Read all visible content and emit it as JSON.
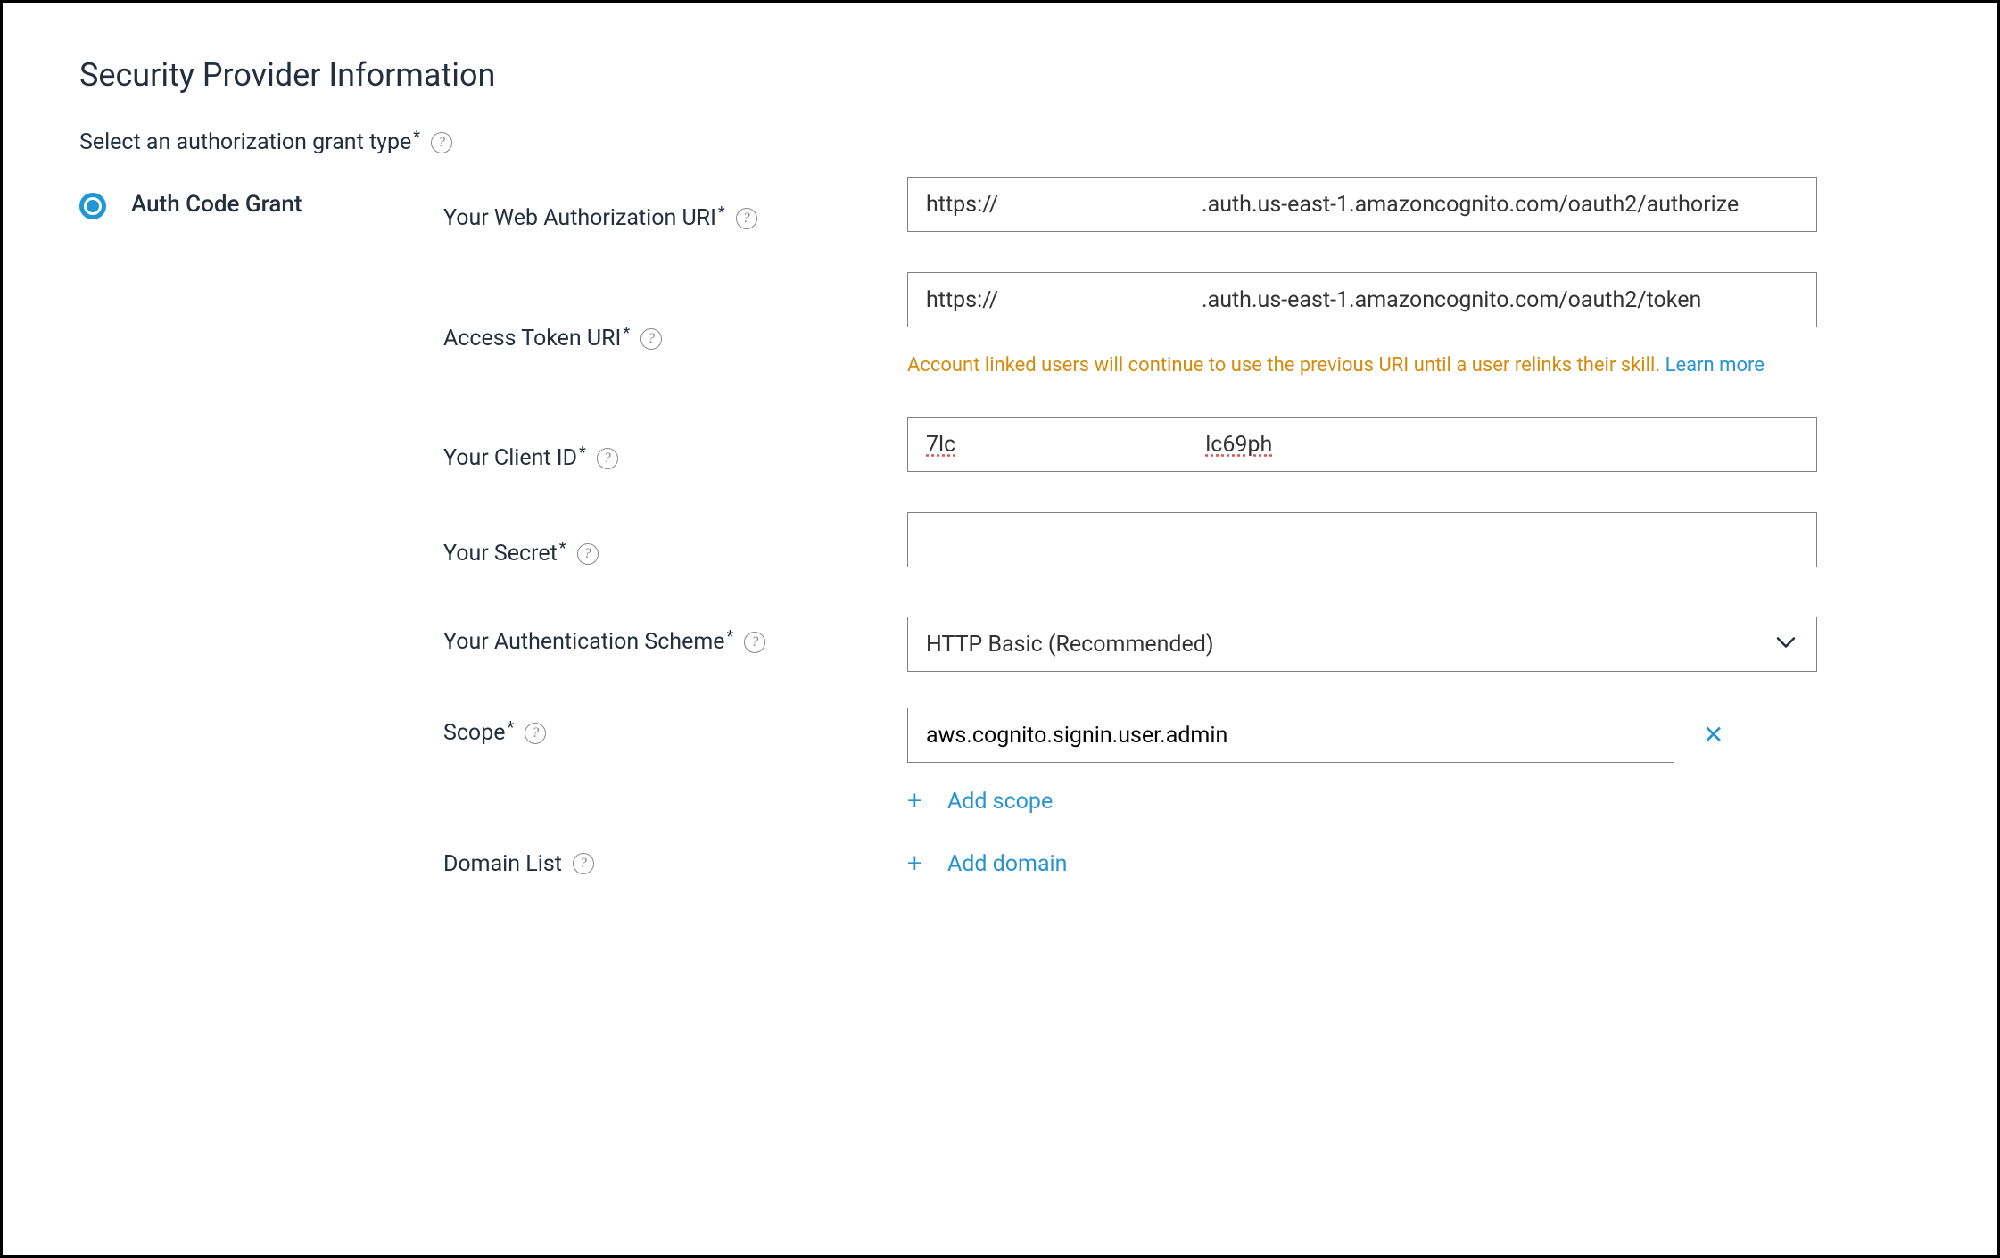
{
  "section": {
    "title": "Security Provider Information"
  },
  "grantType": {
    "label": "Select an authorization grant type",
    "options": {
      "authCode": "Auth Code Grant"
    }
  },
  "fields": {
    "webAuthUri": {
      "label": "Your Web Authorization URI",
      "prefix": "https://",
      "suffix": ".auth.us-east-1.amazoncognito.com/oauth2/authorize"
    },
    "accessTokenUri": {
      "label": "Access Token URI",
      "prefix": "https://",
      "suffix": ".auth.us-east-1.amazoncognito.com/oauth2/token",
      "noteText": "Account linked users will continue to use the previous URI until a user relinks their skill.",
      "noteLink": "Learn more"
    },
    "clientId": {
      "label": "Your Client ID",
      "part1": "7lc",
      "part2": "lc69ph"
    },
    "secret": {
      "label": "Your Secret",
      "value": ""
    },
    "authScheme": {
      "label": "Your Authentication Scheme",
      "value": "HTTP Basic (Recommended)"
    },
    "scope": {
      "label": "Scope",
      "items": [
        "aws.cognito.signin.user.admin"
      ],
      "addLabel": "Add scope"
    },
    "domainList": {
      "label": "Domain List",
      "addLabel": "Add domain"
    }
  },
  "glyphs": {
    "help": "?",
    "remove": "✕",
    "plus": "+"
  },
  "aria": {
    "prefixPlaceholder": "https://"
  }
}
